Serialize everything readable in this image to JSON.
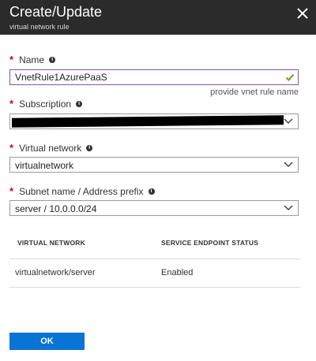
{
  "header": {
    "title": "Create/Update",
    "subtitle": "virtual network rule",
    "close_icon": "close-icon"
  },
  "form": {
    "name": {
      "required_marker": "*",
      "label": "Name",
      "info_icon": "info-icon",
      "value": "VnetRule1AzurePaaS",
      "valid_icon": "checkmark-icon",
      "helper": "provide vnet rule name"
    },
    "subscription": {
      "required_marker": "*",
      "label": "Subscription",
      "info_icon": "info-icon",
      "value": "",
      "redacted": true
    },
    "virtual_network": {
      "required_marker": "*",
      "label": "Virtual network",
      "info_icon": "info-icon",
      "value": "virtualnetwork"
    },
    "subnet": {
      "required_marker": "*",
      "label": "Subnet name / Address prefix",
      "info_icon": "info-icon",
      "value": "server / 10.0.0.0/24"
    }
  },
  "table": {
    "headers": [
      "VIRTUAL NETWORK",
      "SERVICE ENDPOINT STATUS"
    ],
    "rows": [
      {
        "network": "virtualnetwork/server",
        "status": "Enabled"
      }
    ]
  },
  "footer": {
    "ok_label": "OK"
  },
  "colors": {
    "header_bg": "#2b2b2b",
    "required": "#d6001c",
    "active_border": "#8c50a8",
    "valid_check": "#5ea51d",
    "primary_button": "#0a74d4"
  }
}
